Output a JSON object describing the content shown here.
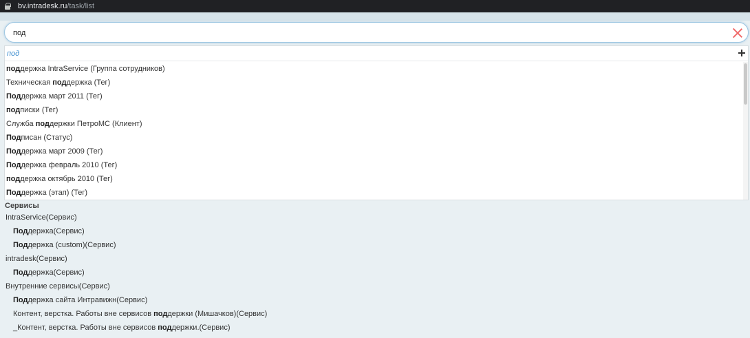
{
  "browser": {
    "url_host": "bv.intradesk.ru",
    "url_path": "/task/list"
  },
  "search": {
    "value": "под"
  },
  "dropdown": {
    "query_echo": "под",
    "suggestions": [
      {
        "match": "под",
        "rest": "держка IntraService (Группа сотрудников)"
      },
      {
        "pre": "Техническая ",
        "match": "под",
        "rest": "держка (Тег)"
      },
      {
        "match": "Под",
        "rest": "держка март 2011 (Тег)"
      },
      {
        "match": "под",
        "rest": "писки (Тег)"
      },
      {
        "pre": "Служба ",
        "match": "под",
        "rest": "держки ПетроМС (Клиент)"
      },
      {
        "match": "Под",
        "rest": "писан (Статус)"
      },
      {
        "match": "Под",
        "rest": "держка март 2009 (Тег)"
      },
      {
        "match": "Под",
        "rest": "держка февраль 2010 (Тег)"
      },
      {
        "match": "под",
        "rest": "держка октябрь 2010 (Тег)"
      },
      {
        "match": "Под",
        "rest": "держка (этап) (Тег)"
      }
    ]
  },
  "services": {
    "title": "Сервисы",
    "items": [
      {
        "level": 0,
        "text": "IntraService(Сервис)"
      },
      {
        "level": 1,
        "match": "Под",
        "rest": "держка(Сервис)"
      },
      {
        "level": 1,
        "match": "Под",
        "rest": "держка (custom)(Сервис)"
      },
      {
        "level": 0,
        "text": "intradesk(Сервис)"
      },
      {
        "level": 1,
        "match": "Под",
        "rest": "держка(Сервис)"
      },
      {
        "level": 0,
        "text": "Внутренние сервисы(Сервис)"
      },
      {
        "level": 1,
        "match": "Под",
        "rest": "держка сайта Интравижн(Сервис)"
      },
      {
        "level": 1,
        "pre": "Контент, верстка. Работы вне сервисов ",
        "match": "под",
        "rest": "держки (Мишачков)(Сервис)"
      },
      {
        "level": 1,
        "pre": "_Контент, верстка. Работы вне сервисов ",
        "match": "под",
        "rest": "держки.(Сервис)"
      }
    ]
  }
}
